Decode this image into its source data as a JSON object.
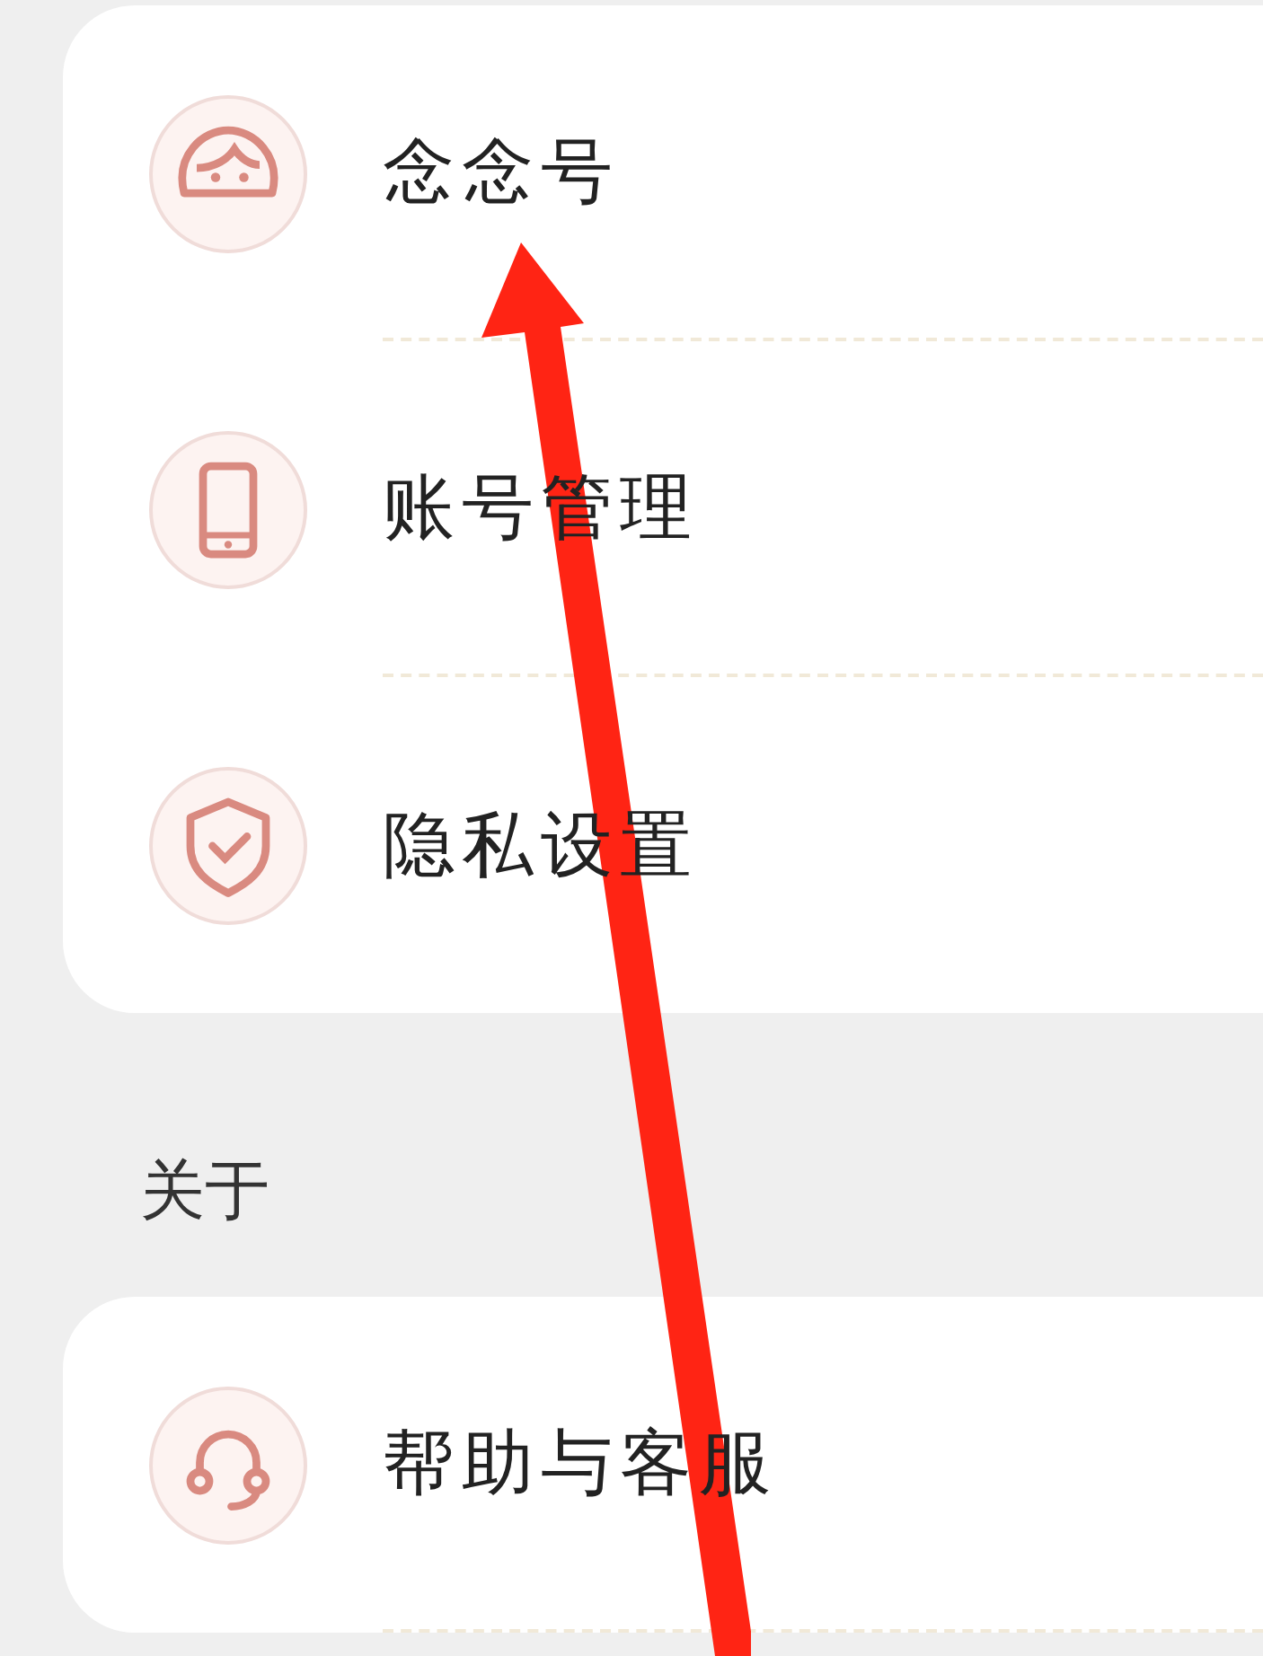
{
  "groups": [
    {
      "items": [
        {
          "label": "念念号"
        },
        {
          "label": "账号管理"
        },
        {
          "label": "隐私设置"
        }
      ]
    },
    {
      "title": "关于",
      "items": [
        {
          "label": "帮助与客服"
        }
      ]
    }
  ]
}
